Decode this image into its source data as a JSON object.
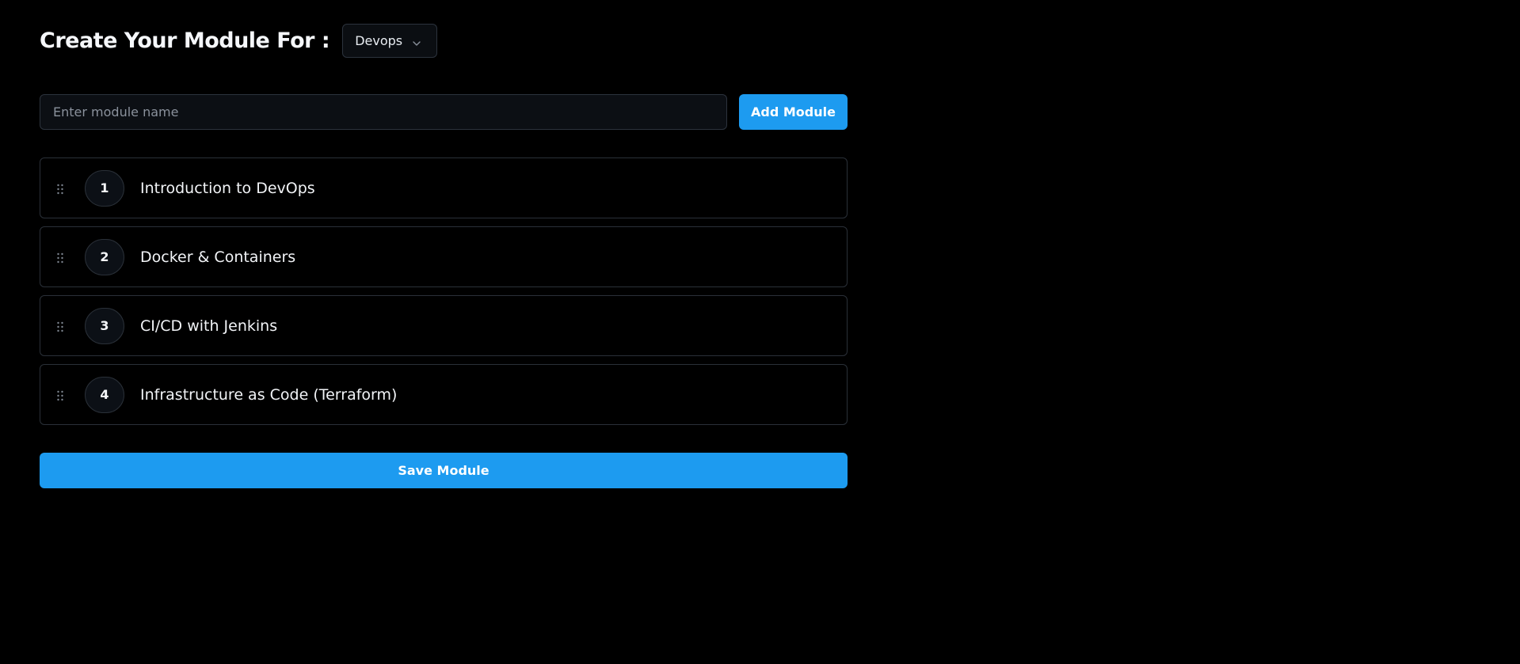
{
  "header": {
    "title": "Create Your Module For :",
    "course_select": {
      "selected": "Devops",
      "icon": "chevron-down-icon"
    }
  },
  "form": {
    "input_value": "",
    "input_placeholder": "Enter module name",
    "add_button_label": "Add Module"
  },
  "modules": [
    {
      "number": "1",
      "name": "Introduction to DevOps"
    },
    {
      "number": "2",
      "name": "Docker & Containers"
    },
    {
      "number": "3",
      "name": "CI/CD with Jenkins"
    },
    {
      "number": "4",
      "name": "Infrastructure as Code (Terraform)"
    }
  ],
  "footer": {
    "save_button_label": "Save Module"
  },
  "colors": {
    "background": "#000000",
    "accent": "#1d9bf0",
    "border": "#2a3038",
    "text": "#f2f4f7",
    "placeholder": "#8a919c"
  }
}
